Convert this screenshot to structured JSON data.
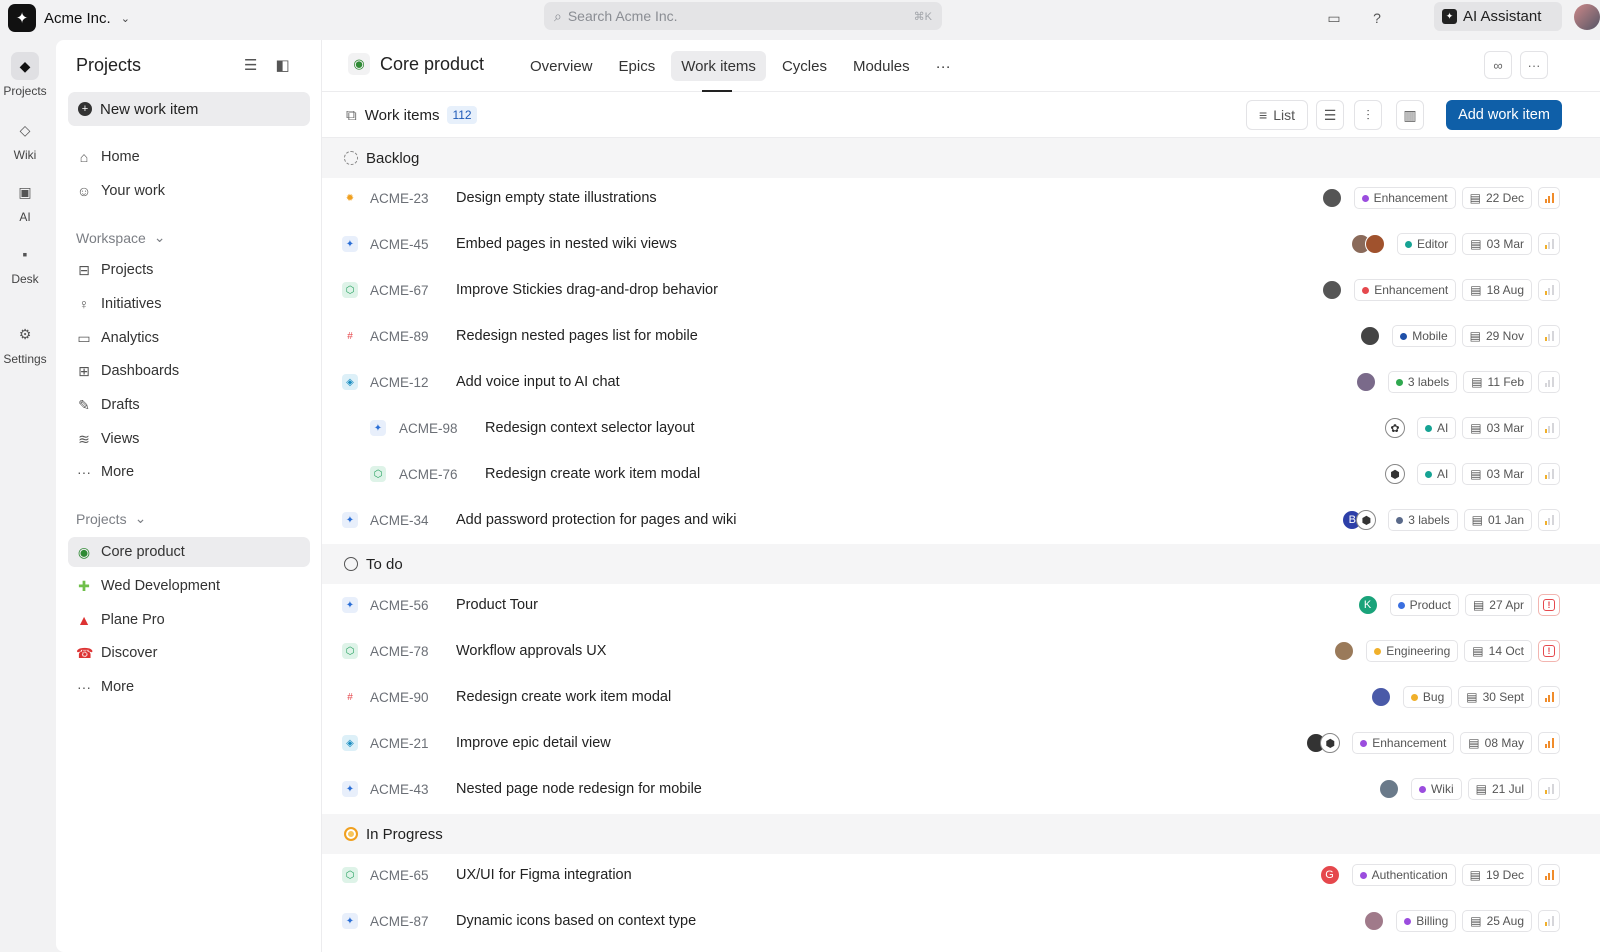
{
  "topbar": {
    "org_name": "Acme Inc.",
    "search_placeholder": "Search Acme Inc.",
    "search_shortcut": "⌘K",
    "assistant_label": "AI Assistant"
  },
  "rail": [
    {
      "label": "Projects",
      "icon": "projects-icon"
    },
    {
      "label": "Wiki",
      "icon": "wiki-icon"
    },
    {
      "label": "AI",
      "icon": "ai-icon"
    },
    {
      "label": "Desk",
      "icon": "desk-icon"
    },
    {
      "label": "Settings",
      "icon": "gear-icon"
    }
  ],
  "sidebar": {
    "title": "Projects",
    "new_item_label": "New work item",
    "top_nav": [
      {
        "label": "Home",
        "icon": "home-icon"
      },
      {
        "label": "Your work",
        "icon": "user-icon"
      }
    ],
    "workspace_label": "Workspace",
    "workspace_nav": [
      {
        "label": "Projects",
        "icon": "briefcase-icon"
      },
      {
        "label": "Initiatives",
        "icon": "bulb-icon"
      },
      {
        "label": "Analytics",
        "icon": "chart-icon"
      },
      {
        "label": "Dashboards",
        "icon": "grid-icon"
      },
      {
        "label": "Drafts",
        "icon": "pencil-icon"
      },
      {
        "label": "Views",
        "icon": "layers-icon"
      },
      {
        "label": "More",
        "icon": "more-icon"
      }
    ],
    "projects_label": "Projects",
    "projects_nav": [
      {
        "label": "Core product",
        "icon": "tractor-icon"
      },
      {
        "label": "Wed Development",
        "icon": "puzzle-icon"
      },
      {
        "label": "Plane Pro",
        "icon": "car-icon"
      },
      {
        "label": "Discover",
        "icon": "phone-icon"
      },
      {
        "label": "More",
        "icon": "more-icon"
      }
    ]
  },
  "header": {
    "project_name": "Core product",
    "tabs": [
      "Overview",
      "Epics",
      "Work items",
      "Cycles",
      "Modules"
    ],
    "more": "···"
  },
  "subbar": {
    "title": "Work items",
    "count": "112",
    "list_label": "List",
    "add_label": "Add work item"
  },
  "groups": {
    "backlog": "Backlog",
    "todo": "To do",
    "inprogress": "In Progress"
  },
  "rows": [
    {
      "id": "ACME-23",
      "name": "Design empty state illustrations",
      "label": "Enhancement",
      "date": "22 Dec"
    },
    {
      "id": "ACME-45",
      "name": "Embed pages in nested wiki views",
      "label": "Editor",
      "date": "03 Mar"
    },
    {
      "id": "ACME-67",
      "name": "Improve Stickies drag-and-drop behavior",
      "label": "Enhancement",
      "date": "18 Aug"
    },
    {
      "id": "ACME-89",
      "name": "Redesign nested pages list for mobile",
      "label": "Mobile",
      "date": "29 Nov"
    },
    {
      "id": "ACME-12",
      "name": "Add voice input to AI chat",
      "label": "3 labels",
      "date": "11 Feb"
    },
    {
      "id": "ACME-98",
      "name": "Redesign context selector layout",
      "label": "AI",
      "date": "03 Mar"
    },
    {
      "id": "ACME-76",
      "name": "Redesign create work item modal",
      "label": "AI",
      "date": "03 Mar"
    },
    {
      "id": "ACME-34",
      "name": "Add password protection for pages and wiki",
      "label": "3 labels",
      "date": "01 Jan",
      "avatar_letter": "B"
    },
    {
      "id": "ACME-56",
      "name": "Product Tour",
      "label": "Product",
      "date": "27 Apr",
      "avatar_letter": "K"
    },
    {
      "id": "ACME-78",
      "name": "Workflow approvals UX",
      "label": "Engineering",
      "date": "14 Oct"
    },
    {
      "id": "ACME-90",
      "name": "Redesign create work item modal",
      "label": "Bug",
      "date": "30 Sept"
    },
    {
      "id": "ACME-21",
      "name": "Improve epic detail view",
      "label": "Enhancement",
      "date": "08 May"
    },
    {
      "id": "ACME-43",
      "name": "Nested page node redesign for mobile",
      "label": "Wiki",
      "date": "21 Jul"
    },
    {
      "id": "ACME-65",
      "name": "UX/UI for Figma integration",
      "label": "Authentication",
      "date": "19 Dec",
      "avatar_letter": "G"
    },
    {
      "id": "ACME-87",
      "name": "Dynamic icons based on context type",
      "label": "Billing",
      "date": "25 Aug"
    }
  ]
}
